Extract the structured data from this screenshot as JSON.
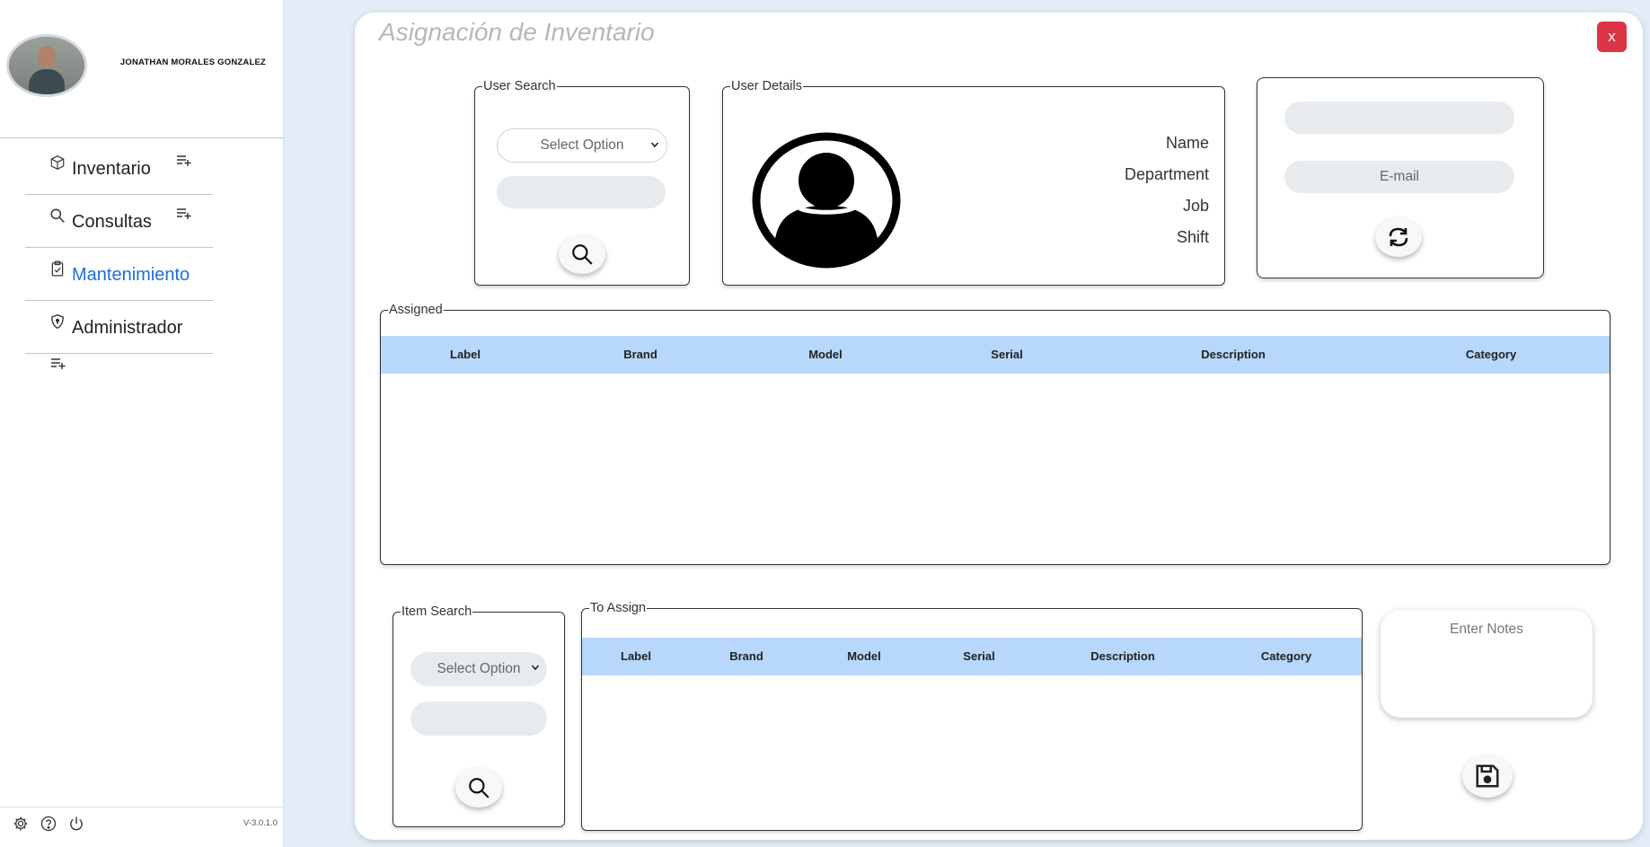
{
  "sidebar": {
    "user_name": "JONATHAN MORALES GONZALEZ",
    "items": [
      {
        "label": "Inventario",
        "icon": "box-icon"
      },
      {
        "label": "Consultas",
        "icon": "search-icon"
      },
      {
        "label": "Mantenimiento",
        "icon": "clipboard-check-icon",
        "active": true
      },
      {
        "label": "Administrador",
        "icon": "shield-icon"
      }
    ],
    "version": "V-3.0.1.0",
    "active_color": "#1f6fd6"
  },
  "panel": {
    "title": "Asignación de Inventario",
    "close_label": "x",
    "close_color": "#dc3545"
  },
  "user_search": {
    "legend": "User Search",
    "select_value": "Select Option"
  },
  "user_details": {
    "legend": "User Details",
    "labels": [
      "Name",
      "Department",
      "Job",
      "Shift"
    ]
  },
  "contact": {
    "email_placeholder": "E-mail"
  },
  "assigned": {
    "legend": "Assigned",
    "columns": [
      "Label",
      "Brand",
      "Model",
      "Serial",
      "Description",
      "Category"
    ],
    "header_color": "#b7d7fb"
  },
  "item_search": {
    "legend": "Item Search",
    "select_value": "Select Option"
  },
  "to_assign": {
    "legend": "To Assign",
    "columns": [
      "Label",
      "Brand",
      "Model",
      "Serial",
      "Description",
      "Category"
    ]
  },
  "notes": {
    "placeholder": "Enter Notes"
  }
}
